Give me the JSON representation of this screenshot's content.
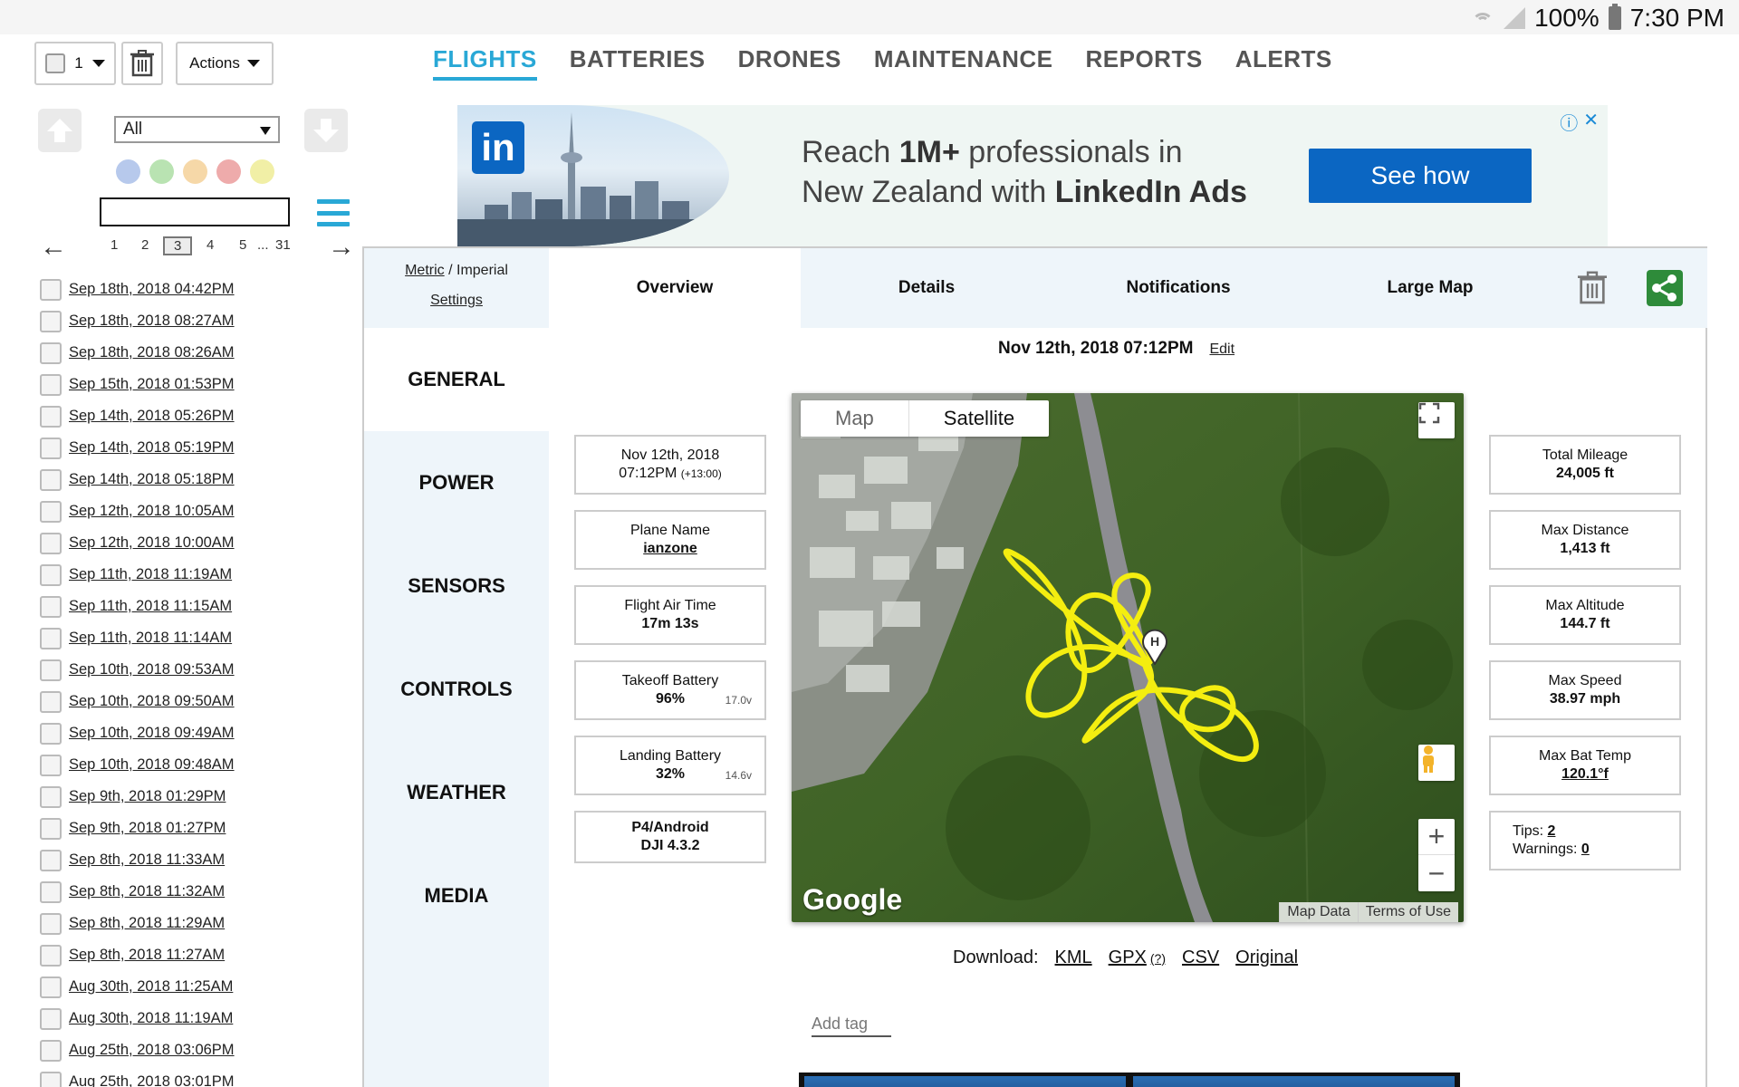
{
  "status_bar": {
    "battery": "100%",
    "time": "7:30 PM"
  },
  "toolbar": {
    "count": "1",
    "actions_label": "Actions"
  },
  "nav": [
    {
      "label": "FLIGHTS",
      "active": true
    },
    {
      "label": "BATTERIES"
    },
    {
      "label": "DRONES"
    },
    {
      "label": "MAINTENANCE"
    },
    {
      "label": "REPORTS"
    },
    {
      "label": "ALERTS"
    }
  ],
  "ad": {
    "logo": "in",
    "line1_pre": "Reach ",
    "line1_bold": "1M+",
    "line1_post": " professionals in",
    "line2_pre": "New Zealand with ",
    "line2_bold": "LinkedIn Ads",
    "cta": "See how",
    "info_icon": "ⓘ",
    "close_icon": "✕"
  },
  "sidebar": {
    "filter_value": "All",
    "dot_colors": [
      "#b7c9ec",
      "#b9e3b2",
      "#f6d8a8",
      "#eeabab",
      "#f1efa6"
    ],
    "pages": [
      "1",
      "2",
      "3",
      "4",
      "5",
      "...",
      "31"
    ],
    "current_page": "3",
    "flights": [
      "Sep 18th, 2018 04:42PM",
      "Sep 18th, 2018 08:27AM",
      "Sep 18th, 2018 08:26AM",
      "Sep 15th, 2018 01:53PM",
      "Sep 14th, 2018 05:26PM",
      "Sep 14th, 2018 05:19PM",
      "Sep 14th, 2018 05:18PM",
      "Sep 12th, 2018 10:05AM",
      "Sep 12th, 2018 10:00AM",
      "Sep 11th, 2018 11:19AM",
      "Sep 11th, 2018 11:15AM",
      "Sep 11th, 2018 11:14AM",
      "Sep 10th, 2018 09:53AM",
      "Sep 10th, 2018 09:50AM",
      "Sep 10th, 2018 09:49AM",
      "Sep 10th, 2018 09:48AM",
      "Sep 9th, 2018 01:29PM",
      "Sep 9th, 2018 01:27PM",
      "Sep 8th, 2018 11:33AM",
      "Sep 8th, 2018 11:32AM",
      "Sep 8th, 2018 11:29AM",
      "Sep 8th, 2018 11:27AM",
      "Aug 30th, 2018 11:25AM",
      "Aug 30th, 2018 11:19AM",
      "Aug 25th, 2018 03:06PM",
      "Aug 25th, 2018 03:01PM"
    ]
  },
  "units": {
    "metric": "Metric",
    "sep": " / Imperial",
    "settings": "Settings"
  },
  "sections": [
    "GENERAL",
    "POWER",
    "SENSORS",
    "CONTROLS",
    "WEATHER",
    "MEDIA"
  ],
  "tabs": [
    "Overview",
    "Details",
    "Notifications",
    "Large Map"
  ],
  "flight": {
    "date": "Nov 12th, 2018 07:12PM",
    "edit": "Edit",
    "left_stats": [
      {
        "label": "Nov 12th, 2018",
        "value": "07:12PM",
        "extra": "(+13:00)"
      },
      {
        "label": "Plane Name",
        "value": "ianzone",
        "link": true
      },
      {
        "label": "Flight Air Time",
        "value": "17m 13s"
      },
      {
        "label": "Takeoff Battery",
        "value": "96%",
        "volt": "17.0v"
      },
      {
        "label": "Landing Battery",
        "value": "32%",
        "volt": "14.6v"
      },
      {
        "label": "P4/Android",
        "value": "DJI 4.3.2",
        "bold_label": true
      }
    ],
    "right_stats": [
      {
        "label": "Total Mileage",
        "value": "24,005 ft"
      },
      {
        "label": "Max Distance",
        "value": "1,413 ft"
      },
      {
        "label": "Max Altitude",
        "value": "144.7 ft"
      },
      {
        "label": "Max Speed",
        "value": "38.97 mph"
      },
      {
        "label": "Max Bat Temp",
        "value": "120.1°f",
        "link": true
      }
    ],
    "tips_label": "Tips: ",
    "tips": "2",
    "warnings_label": "Warnings: ",
    "warnings": "0"
  },
  "map": {
    "tab_map": "Map",
    "tab_satellite": "Satellite",
    "home_marker": "H",
    "logo": "Google",
    "map_data": "Map Data",
    "terms": "Terms of Use",
    "path_color": "#f4ee10"
  },
  "download": {
    "label": "Download:",
    "kml": "KML",
    "gpx": "GPX",
    "gpx_help": "(?)",
    "csv": "CSV",
    "original": "Original"
  },
  "add_tag_placeholder": "Add tag"
}
